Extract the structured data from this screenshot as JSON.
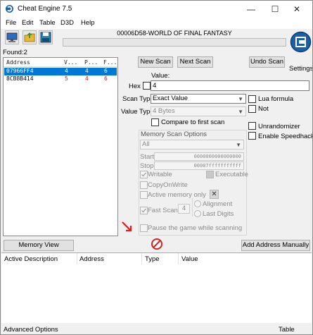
{
  "window": {
    "title": "Cheat Engine 7.5",
    "controls": {
      "minimize": "—",
      "maximize": "☐",
      "close": "✕"
    }
  },
  "menu": [
    "File",
    "Edit",
    "Table",
    "D3D",
    "Help"
  ],
  "process": "00006D58-WORLD OF FINAL FANTASY",
  "settings_label": "Settings",
  "found": {
    "label": "Found:2",
    "columns": [
      "Address",
      "V...",
      "P...",
      "F..."
    ],
    "rows": [
      {
        "address": "07966FF4",
        "value": "4",
        "previous": "4",
        "first": "6",
        "selected": true
      },
      {
        "address": "8CB8B414",
        "value": "5",
        "previous": "4",
        "first": "6",
        "selected": false
      }
    ]
  },
  "scan": {
    "new_scan": "New Scan",
    "next_scan": "Next Scan",
    "undo_scan": "Undo Scan",
    "value_label": "Value:",
    "hex_label": "Hex",
    "value": "4",
    "scan_type_label": "Scan Type",
    "scan_type": "Exact Value",
    "value_type_label": "Value Type",
    "value_type": "4 Bytes",
    "compare_first": "Compare to first scan",
    "lua_formula": "Lua formula",
    "not_label": "Not",
    "unrandomizer": "Unrandomizer",
    "enable_speedhack": "Enable Speedhack"
  },
  "memory_options": {
    "title": "Memory Scan Options",
    "region": "All",
    "start_label": "Start",
    "start": "0000000000000000",
    "stop_label": "Stop",
    "stop": "00007fffffffffff",
    "writable": "Writable",
    "executable": "Executable",
    "copy_on_write": "CopyOnWrite",
    "active_memory_only": "Active memory only",
    "fast_scan": "Fast Scan",
    "fast_scan_value": "4",
    "alignment": "Alignment",
    "last_digits": "Last Digits",
    "pause_game": "Pause the game while scanning"
  },
  "bottom": {
    "memory_view": "Memory View",
    "add_address": "Add Address Manually",
    "columns": [
      "Active Description",
      "Address",
      "Type",
      "Value"
    ]
  },
  "status": {
    "advanced_options": "Advanced Options",
    "table_extras": "Table Extras"
  },
  "colors": {
    "selection": "#0078d7",
    "red_value": "#e02020",
    "stop_icon": "#d82020"
  }
}
